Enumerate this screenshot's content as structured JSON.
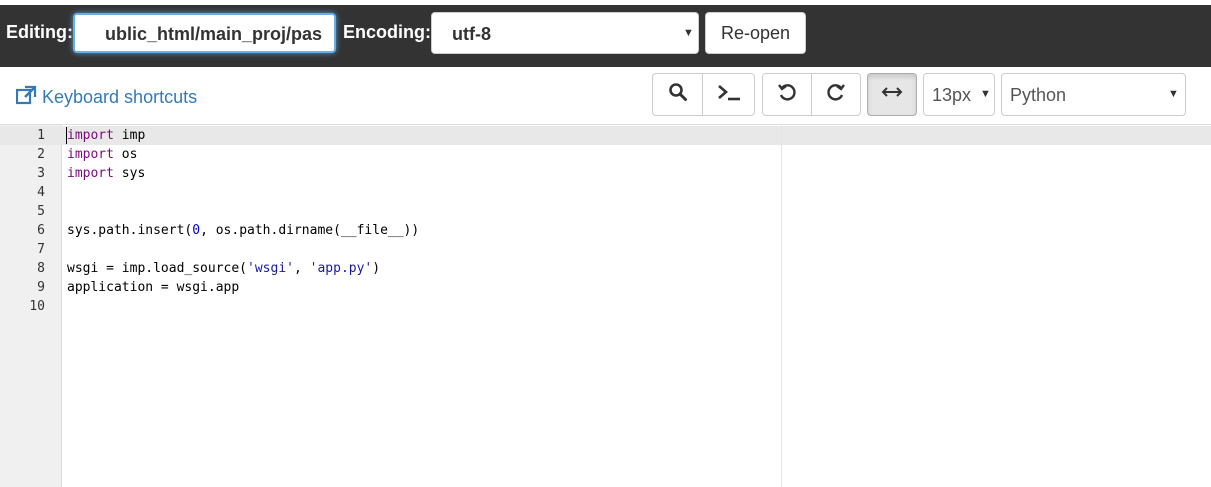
{
  "topbar": {
    "editing_label": "Editing:",
    "path_value": "ublic_html/main_proj/pas",
    "encoding_label": "Encoding:",
    "encoding_value": "utf-8",
    "reopen_label": "Re-open"
  },
  "toolbar": {
    "keyboard_shortcuts": "Keyboard shortcuts",
    "font_size": "13px",
    "language": "Python",
    "icons": [
      "external-link-icon",
      "search-icon",
      "terminal-icon",
      "undo-icon",
      "redo-icon",
      "wrap-toggle-icon"
    ]
  },
  "editor": {
    "line_numbers": [
      "1",
      "2",
      "3",
      "4",
      "5",
      "6",
      "7",
      "8",
      "9",
      "10"
    ],
    "lines": [
      {
        "tokens": [
          {
            "t": "import",
            "c": "kw"
          },
          {
            "t": " imp",
            "c": ""
          }
        ]
      },
      {
        "tokens": [
          {
            "t": "import",
            "c": "kw"
          },
          {
            "t": " os",
            "c": ""
          }
        ]
      },
      {
        "tokens": [
          {
            "t": "import",
            "c": "kw"
          },
          {
            "t": " sys",
            "c": ""
          }
        ]
      },
      {
        "tokens": []
      },
      {
        "tokens": []
      },
      {
        "tokens": [
          {
            "t": "sys.path.insert(",
            "c": ""
          },
          {
            "t": "0",
            "c": "num"
          },
          {
            "t": ", os.path.dirname(__file__))",
            "c": ""
          }
        ]
      },
      {
        "tokens": []
      },
      {
        "tokens": [
          {
            "t": "wsgi = imp.load_source(",
            "c": ""
          },
          {
            "t": "'wsgi'",
            "c": "str"
          },
          {
            "t": ", ",
            "c": ""
          },
          {
            "t": "'app.py'",
            "c": "str"
          },
          {
            "t": ")",
            "c": ""
          }
        ]
      },
      {
        "tokens": [
          {
            "t": "application = wsgi.app",
            "c": ""
          }
        ]
      },
      {
        "tokens": []
      }
    ]
  },
  "colors": {
    "topbar_bg": "#333333",
    "link": "#337ab7",
    "keyword": "#7a0a7a",
    "string": "#1a1aa6"
  }
}
